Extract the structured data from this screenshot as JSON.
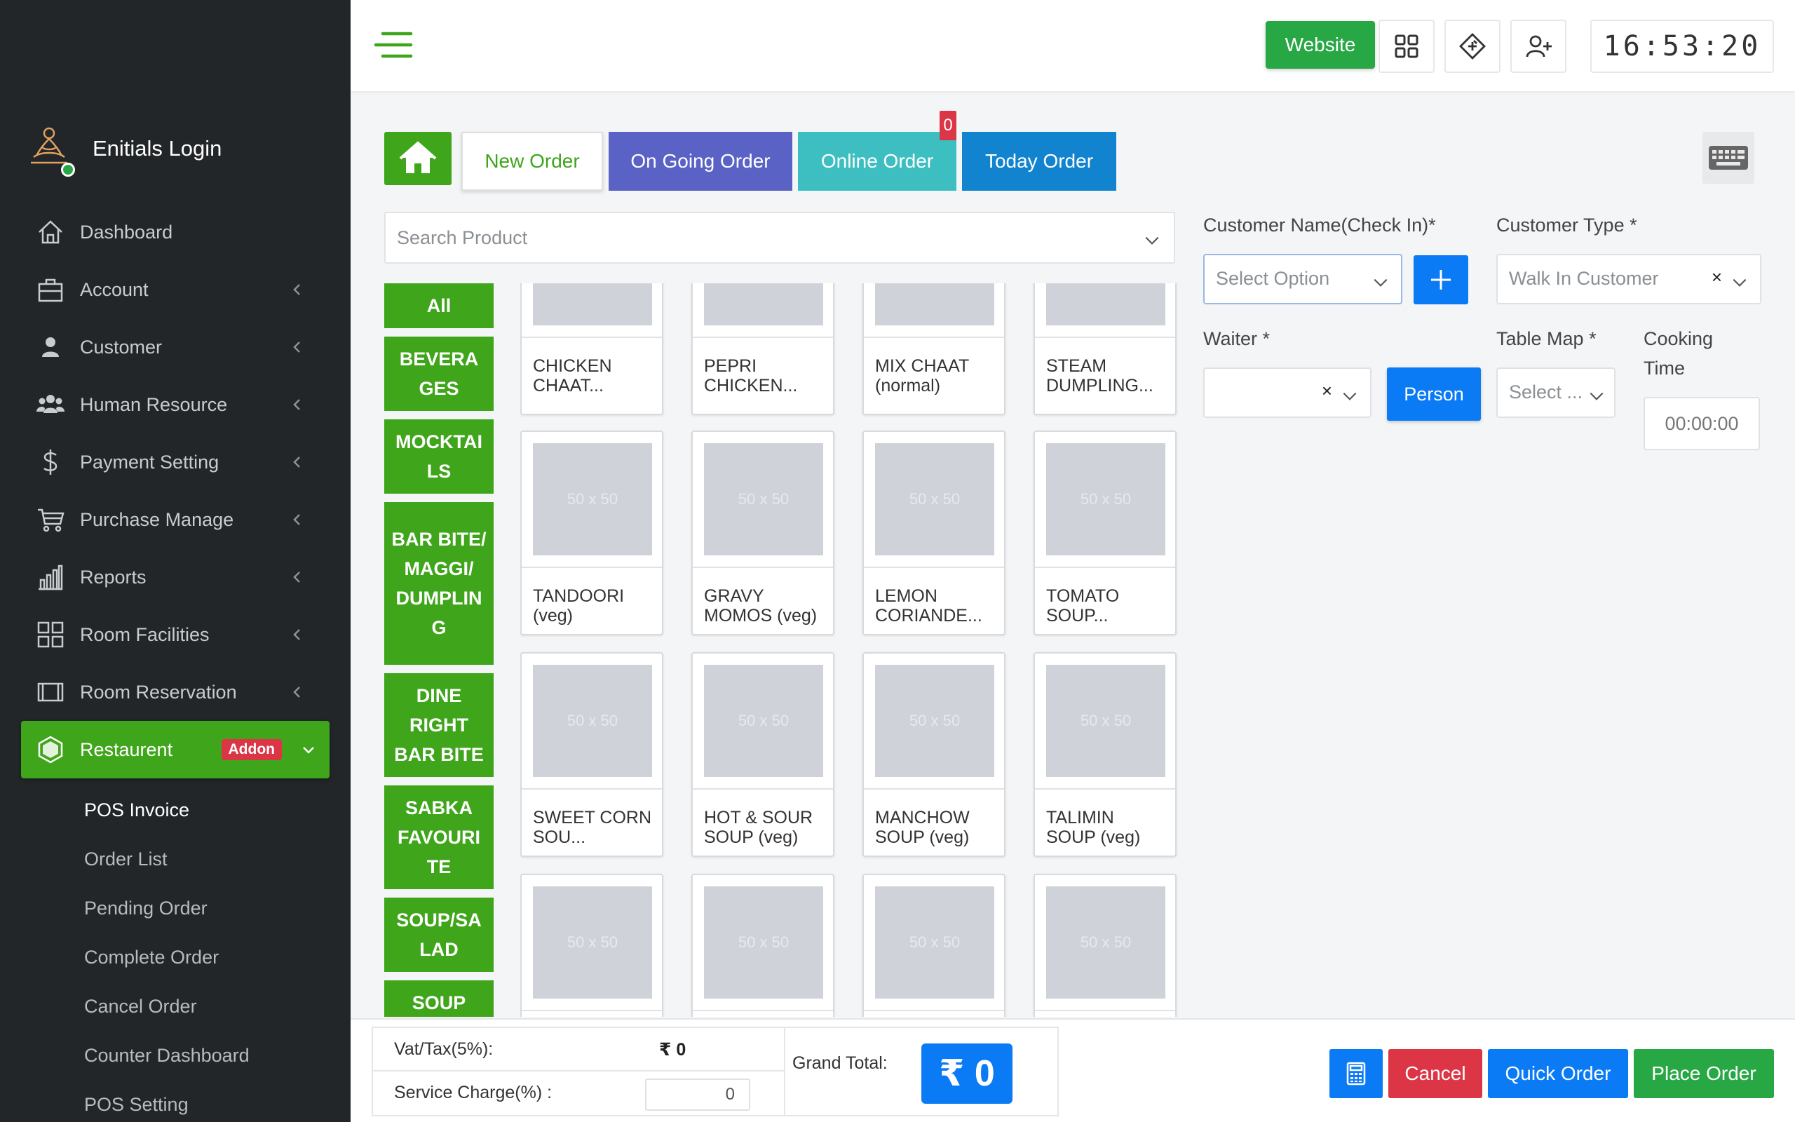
{
  "brand": {
    "name": "Enitials Login"
  },
  "sidebar": {
    "items": [
      {
        "label": "Dashboard",
        "icon": "home-icon"
      },
      {
        "label": "Account",
        "icon": "briefcase-icon"
      },
      {
        "label": "Customer",
        "icon": "user-icon"
      },
      {
        "label": "Human Resource",
        "icon": "users-icon"
      },
      {
        "label": "Payment Setting",
        "icon": "dollar-icon"
      },
      {
        "label": "Purchase Manage",
        "icon": "cart-icon"
      },
      {
        "label": "Reports",
        "icon": "chart-icon"
      },
      {
        "label": "Room Facilities",
        "icon": "grid-icon"
      },
      {
        "label": "Room Reservation",
        "icon": "film-icon"
      }
    ],
    "active": {
      "label": "Restaurent",
      "badge": "Addon",
      "icon": "hexagon-icon"
    },
    "submenu": [
      "POS Invoice",
      "Order List",
      "Pending Order",
      "Complete Order",
      "Cancel Order",
      "Counter Dashboard",
      "POS Setting"
    ]
  },
  "header": {
    "website": "Website",
    "clock": "16:53:20"
  },
  "tabs": {
    "new_order": "New Order",
    "ongoing": "On Going Order",
    "online": "Online Order",
    "online_badge": "0",
    "today": "Today Order"
  },
  "search": {
    "placeholder": "Search Product"
  },
  "categories": [
    "All",
    "BEVERA GES",
    "MOCKTAI LS",
    "BAR BITE/ MAGGI/ DUMPLIN G",
    "DINE RIGHT BAR BITE",
    "SABKA FAVOURI TE",
    "SOUP/SA LAD",
    "SOUP"
  ],
  "products": {
    "placeholder": "50 x 50",
    "items": [
      "CHICKEN CHAAT...",
      "PEPRI CHICKEN...",
      "MIX CHAAT (normal)",
      "STEAM DUMPLING...",
      "TANDOORI (veg)",
      "GRAVY MOMOS (veg)",
      "LEMON CORIANDE...",
      "TOMATO SOUP...",
      "SWEET CORN SOU...",
      "HOT & SOUR SOUP (veg)",
      "MANCHOW SOUP (veg)",
      "TALIMIN SOUP (veg)",
      "",
      "",
      "",
      ""
    ]
  },
  "form": {
    "customer_name_label": "Customer Name(Check In)*",
    "customer_name_value": "Select Option",
    "customer_type_label": "Customer Type *",
    "customer_type_value": "Walk In Customer",
    "waiter_label": "Waiter *",
    "person_button": "Person",
    "table_map_label": "Table Map *",
    "table_map_value": "Select ...",
    "cooking_label_1": "Cooking",
    "cooking_label_2": "Time",
    "cooking_value": "00:00:00"
  },
  "footer": {
    "vat_label": "Vat/Tax(5%):",
    "vat_value": "₹ 0",
    "service_label": "Service Charge(%) :",
    "service_value": "0",
    "grand_label": "Grand Total:",
    "grand_value": "₹ 0",
    "cancel": "Cancel",
    "quick_order": "Quick Order",
    "place_order": "Place Order"
  },
  "colors": {
    "sidebar_bg": "#222629",
    "accent_green": "#3fa51a",
    "primary_blue": "#0a7bf5",
    "danger_red": "#dc3545",
    "ongoing_purple": "#5b62c6",
    "online_teal": "#3dbfc1",
    "today_blue": "#1183cf"
  }
}
